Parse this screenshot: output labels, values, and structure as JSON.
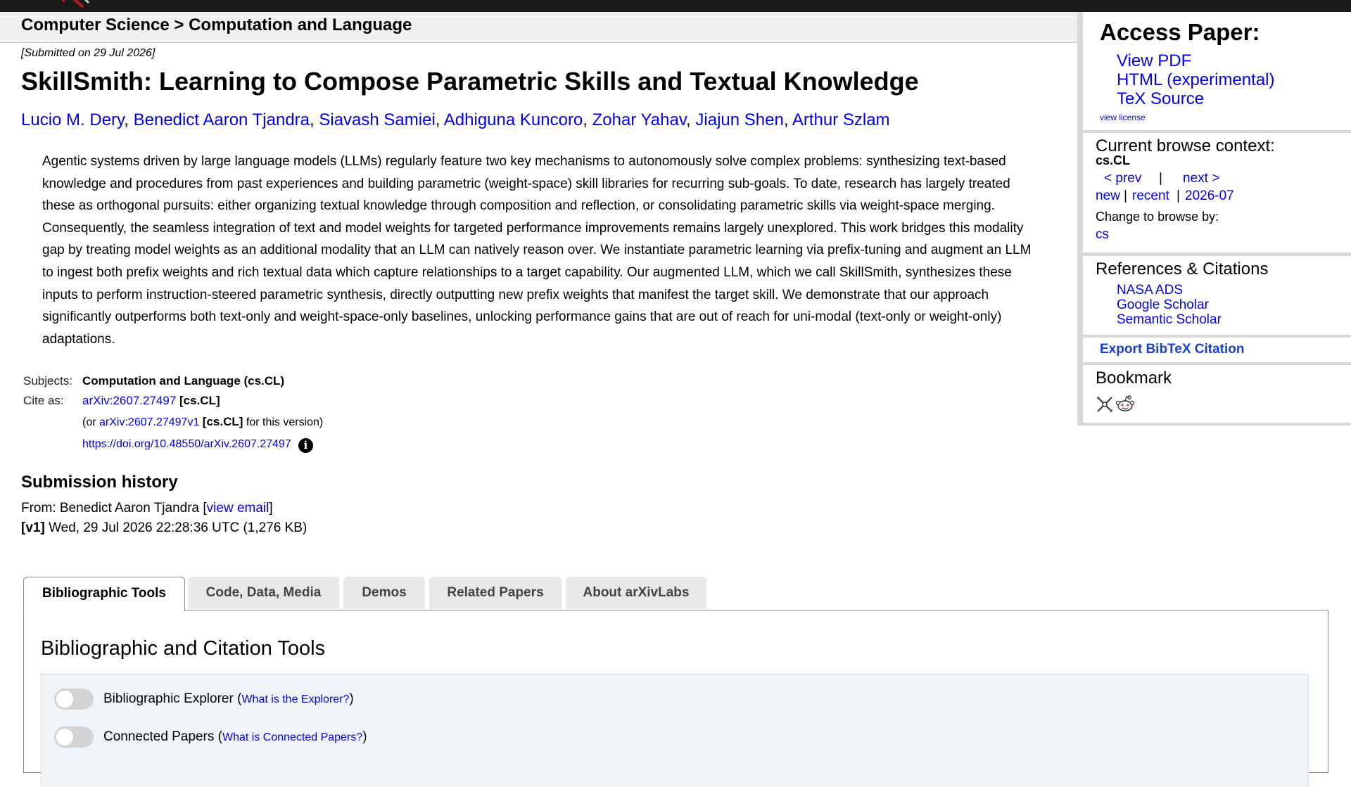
{
  "breadcrumb": "Computer Science > Computation and Language",
  "submitted": "[Submitted on 29 Jul 2026]",
  "title": "SkillSmith: Learning to Compose Parametric Skills and Textual Knowledge",
  "authors": [
    "Lucio M. Dery",
    "Benedict Aaron Tjandra",
    "Siavash Samiei",
    "Adhiguna Kuncoro",
    "Zohar Yahav",
    "Jiajun Shen",
    "Arthur Szlam"
  ],
  "abstract": "Agentic systems driven by large language models (LLMs) regularly feature two key mechanisms to autonomously solve complex problems: synthesizing text-based knowledge and procedures from past experiences and building parametric (weight-space) skill libraries for recurring sub-goals. To date, research has largely treated these as orthogonal pursuits: either organizing textual knowledge through composition and reflection, or consolidating parametric skills via weight-space merging. Consequently, the seamless integration of text and model weights for targeted performance improvements remains largely unexplored. This work bridges this modality gap by treating model weights as an additional modality that an LLM can natively reason over. We instantiate parametric learning via prefix-tuning and augment an LLM to ingest both prefix weights and rich textual data which capture relationships to a target capability. Our augmented LLM, which we call SkillSmith, synthesizes these inputs to perform instruction-steered parametric synthesis, directly outputting new prefix weights that manifest the target skill. We demonstrate that our approach significantly outperforms both text-only and weight-space-only baselines, unlocking performance gains that are out of reach for uni-modal (text-only or weight-only) adaptations.",
  "meta": {
    "subjects_label": "Subjects:",
    "subjects_value": "Computation and Language (cs.CL)",
    "cite_label": "Cite as:",
    "cite_id": "arXiv:2607.27497",
    "cite_cat": "[cs.CL]",
    "or_prefix": "(or",
    "version_id": "arXiv:2607.27497v1",
    "version_cat": "[cs.CL]",
    "version_suffix": "for this version)",
    "doi": "https://doi.org/10.48550/arXiv.2607.27497",
    "info_glyph": "i"
  },
  "submission": {
    "heading": "Submission history",
    "from_prefix": "From: Benedict Aaron Tjandra [",
    "view_email": "view email",
    "from_suffix": "]",
    "version_tag": "[v1]",
    "version_line": "Wed, 29 Jul 2026 22:28:36 UTC (1,276 KB)"
  },
  "sidebar": {
    "access_heading": "Access Paper:",
    "links": [
      "View PDF",
      "HTML (experimental)",
      "TeX Source"
    ],
    "view_license": "view license",
    "browse_heading": "Current browse context:",
    "browse_context": "cs.CL",
    "prev": "< prev",
    "sep": "|",
    "next": "next >",
    "new": "new",
    "recent": "recent",
    "date": "2026-07",
    "change_label": "Change to browse by:",
    "change_cat": "cs",
    "refs_heading": "References & Citations",
    "refs": [
      "NASA ADS",
      "Google Scholar",
      "Semantic Scholar"
    ],
    "export": "Export BibTeX Citation",
    "bookmark_heading": "Bookmark"
  },
  "tabs": [
    "Bibliographic Tools",
    "Code, Data, Media",
    "Demos",
    "Related Papers",
    "About arXivLabs"
  ],
  "panel": {
    "heading": "Bibliographic and Citation Tools",
    "tools": [
      {
        "label": "Bibliographic Explorer",
        "help": "What is the Explorer?"
      },
      {
        "label": "Connected Papers",
        "help": "What is Connected Papers?"
      }
    ]
  },
  "colors": {
    "link": "#0000ee",
    "topbar": "#1a1a1a",
    "logo_accent": "#b31b1b"
  }
}
